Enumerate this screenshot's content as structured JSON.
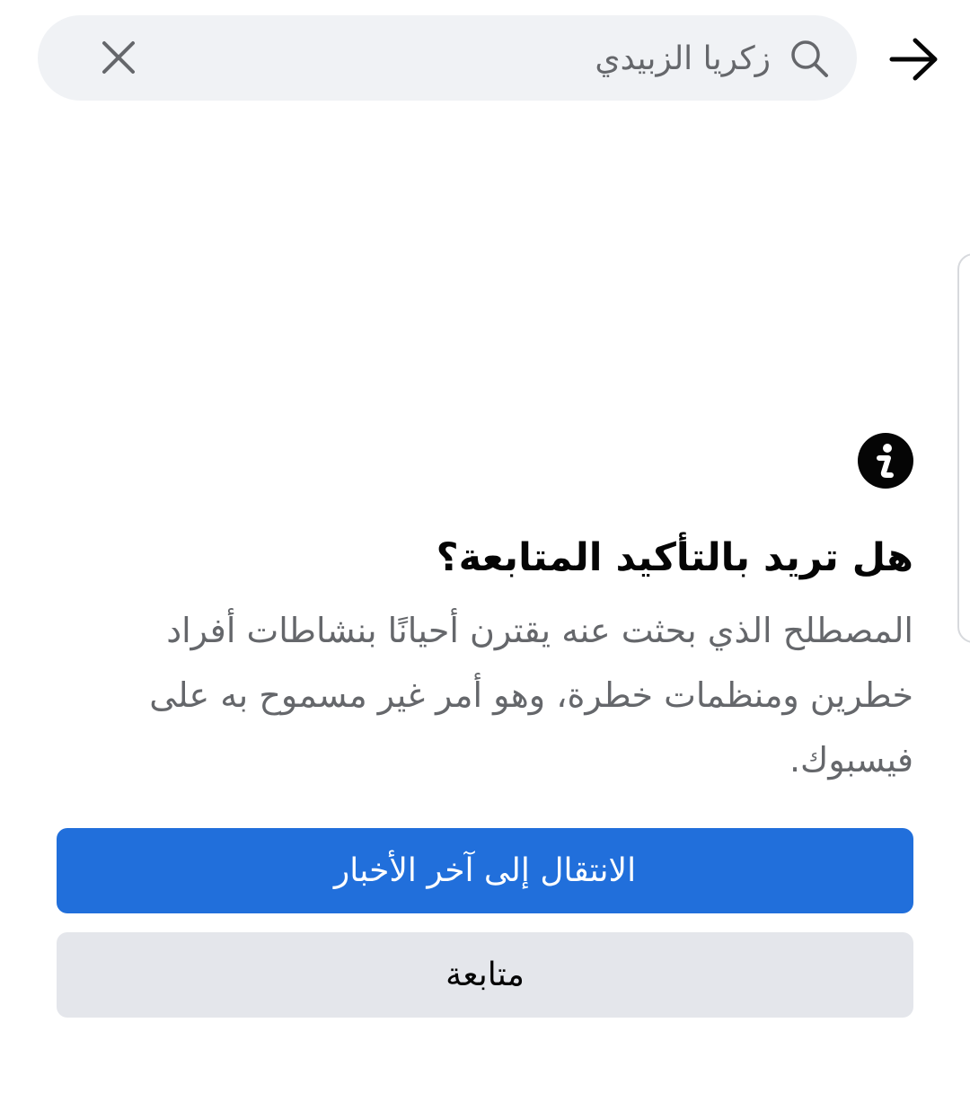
{
  "header": {
    "back_icon": "arrow-right-icon",
    "search": {
      "icon": "search-icon",
      "value": "زكريا الزبيدي",
      "clear_icon": "close-icon"
    }
  },
  "warning": {
    "icon": "info-icon",
    "title": "هل تريد بالتأكيد المتابعة؟",
    "body": "المصطلح الذي بحثت عنه يقترن أحيانًا بنشاطات أفراد خطرين ومنظمات خطرة، وهو أمر غير مسموح به على فيسبوك."
  },
  "actions": {
    "primary_label": "الانتقال إلى آخر الأخبار",
    "secondary_label": "متابعة"
  },
  "colors": {
    "primary_button": "#216fdb",
    "secondary_button": "#e4e6eb",
    "search_background": "#f0f2f5",
    "body_text": "#65676b",
    "title_text": "#050505"
  }
}
